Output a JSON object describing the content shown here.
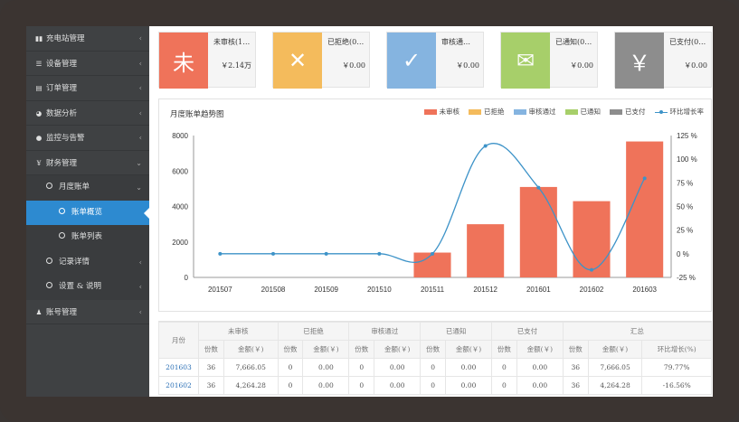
{
  "sidebar": {
    "items": [
      {
        "label": "充电站管理",
        "icon": "bar-chart-icon"
      },
      {
        "label": "设备管理",
        "icon": "list-icon"
      },
      {
        "label": "订单管理",
        "icon": "document-icon"
      },
      {
        "label": "数据分析",
        "icon": "pie-chart-icon"
      },
      {
        "label": "监控与告警",
        "icon": "comment-icon"
      },
      {
        "label": "财务管理",
        "icon": "yen-icon"
      },
      {
        "label": "账号管理",
        "icon": "user-icon"
      }
    ],
    "finance_sub": {
      "monthly": "月度账单",
      "overview": "账单概览",
      "list": "账单列表",
      "records": "记录详情",
      "settings": "设置 & 说明"
    }
  },
  "cards": [
    {
      "label": "未审核(1…",
      "value": "￥2.14万",
      "icon": "未",
      "color": "#ef735a"
    },
    {
      "label": "已拒绝(0…",
      "value": "￥0.00",
      "icon": "✕",
      "color": "#f4bb5c"
    },
    {
      "label": "审核通…",
      "value": "￥0.00",
      "icon": "✓",
      "color": "#85b4e0"
    },
    {
      "label": "已通知(0…",
      "value": "￥0.00",
      "icon": "✉",
      "color": "#a7cf6a"
    },
    {
      "label": "已支付(0…",
      "value": "￥0.00",
      "icon": "￥",
      "color": "#8d8d8d"
    }
  ],
  "chart_data": {
    "type": "bar",
    "title": "月度账单趋势图",
    "categories": [
      "201507",
      "201508",
      "201509",
      "201510",
      "201511",
      "201512",
      "201601",
      "201602",
      "201603"
    ],
    "series": [
      {
        "name": "未审核",
        "type": "bar",
        "color": "#ef735a",
        "values": [
          0,
          0,
          0,
          0,
          1400,
          3000,
          5100,
          4300,
          7666
        ]
      },
      {
        "name": "已拒绝",
        "type": "bar",
        "color": "#f4bb5c",
        "values": [
          0,
          0,
          0,
          0,
          0,
          0,
          0,
          0,
          0
        ]
      },
      {
        "name": "审核通过",
        "type": "bar",
        "color": "#85b4e0",
        "values": [
          0,
          0,
          0,
          0,
          0,
          0,
          0,
          0,
          0
        ]
      },
      {
        "name": "已通知",
        "type": "bar",
        "color": "#a7cf6a",
        "values": [
          0,
          0,
          0,
          0,
          0,
          0,
          0,
          0,
          0
        ]
      },
      {
        "name": "已支付",
        "type": "bar",
        "color": "#8d8d8d",
        "values": [
          0,
          0,
          0,
          0,
          0,
          0,
          0,
          0,
          0
        ]
      },
      {
        "name": "环比增长率",
        "type": "line",
        "color": "#3d93c8",
        "axis": "right",
        "values": [
          0,
          0,
          0,
          0,
          0,
          114,
          70,
          -17,
          79.77
        ]
      }
    ],
    "ylim": [
      0,
      8000
    ],
    "yticks": [
      "8000",
      "6000",
      "4000",
      "2000",
      "0"
    ],
    "y2lim": [
      -25,
      125
    ],
    "y2ticks": [
      "125 %",
      "100 %",
      "75 %",
      "50 %",
      "25 %",
      "0 %",
      "-25 %"
    ],
    "legend_position": "top-right",
    "grid": false
  },
  "table": {
    "group_headers": [
      "未审核",
      "已拒绝",
      "审核通过",
      "已通知",
      "已支付",
      "汇总"
    ],
    "month_header": "月份",
    "sub_headers": [
      "份数",
      "金额(￥)",
      "份数",
      "金额(￥)",
      "份数",
      "金额(￥)",
      "份数",
      "金额(￥)",
      "份数",
      "金额(￥)",
      "份数",
      "金额(￥)",
      "环比增长(%)"
    ],
    "rows": [
      [
        "201603",
        "36",
        "7,666.05",
        "0",
        "0.00",
        "0",
        "0.00",
        "0",
        "0.00",
        "0",
        "0.00",
        "36",
        "7,666.05",
        "79.77%"
      ],
      [
        "201602",
        "36",
        "4,264.28",
        "0",
        "0.00",
        "0",
        "0.00",
        "0",
        "0.00",
        "0",
        "0.00",
        "36",
        "4,264.28",
        "-16.56%"
      ]
    ]
  }
}
